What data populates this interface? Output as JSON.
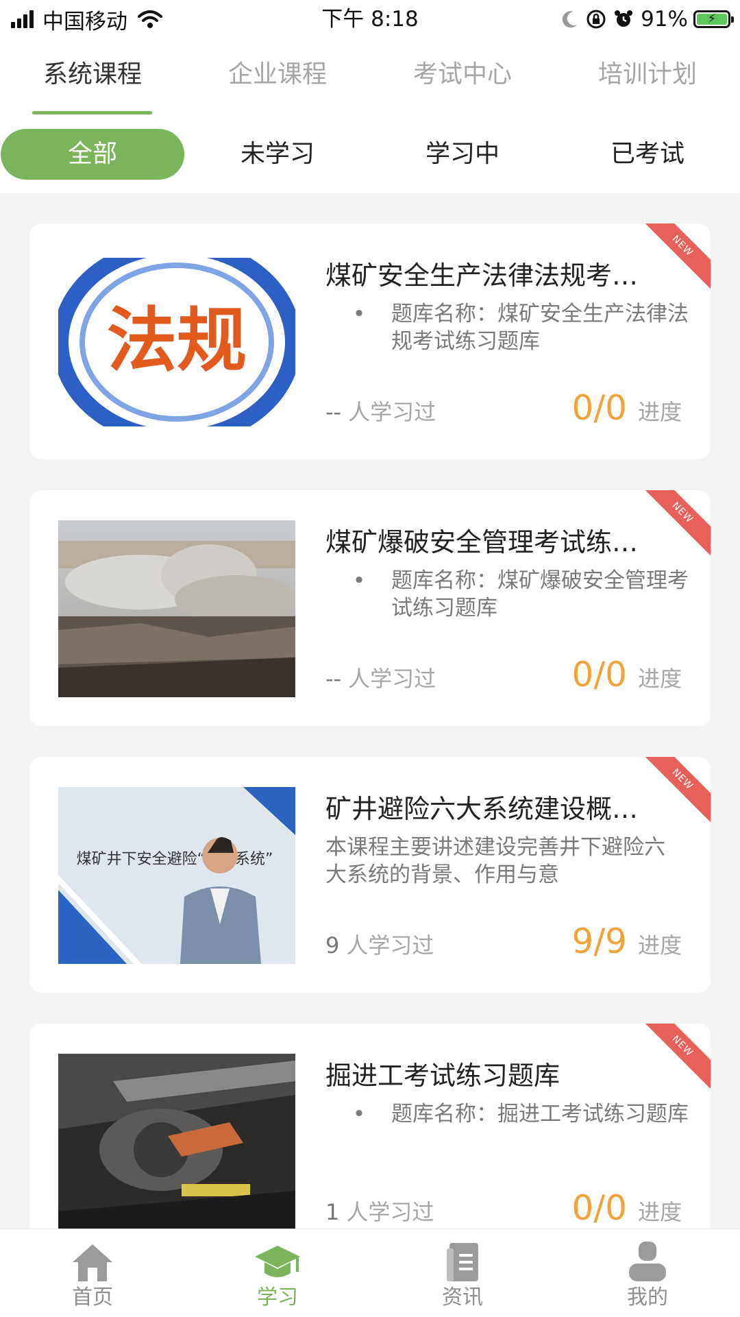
{
  "status_bar": {
    "carrier": "中国移动",
    "time": "下午 8:18",
    "battery_percent": "91%"
  },
  "top_tabs": [
    {
      "label": "系统课程",
      "active": true
    },
    {
      "label": "企业课程",
      "active": false
    },
    {
      "label": "考试中心",
      "active": false
    },
    {
      "label": "培训计划",
      "active": false
    }
  ],
  "filters": [
    {
      "label": "全部",
      "active": true
    },
    {
      "label": "未学习",
      "active": false
    },
    {
      "label": "学习中",
      "active": false
    },
    {
      "label": "已考试",
      "active": false
    }
  ],
  "courses": [
    {
      "title": "煤矿安全生产法律法规考…",
      "bullet": "•",
      "desc": "题库名称：煤矿安全生产法律法规考试练习题库",
      "learners_count": "--",
      "learners_label": "人学习过",
      "progress": "0/0",
      "progress_label": "进度",
      "ribbon": "NEW",
      "thumb_text": "法规"
    },
    {
      "title": "煤矿爆破安全管理考试练…",
      "bullet": "•",
      "desc": "题库名称：煤矿爆破安全管理考试练习题库",
      "learners_count": "--",
      "learners_label": "人学习过",
      "progress": "0/0",
      "progress_label": "进度",
      "ribbon": "NEW"
    },
    {
      "title": "矿井避险六大系统建设概…",
      "desc": "本课程主要讲述建设完善井下避险六大系统的背景、作用与意",
      "learners_count": "9",
      "learners_label": "人学习过",
      "progress": "9/9",
      "progress_label": "进度",
      "ribbon": "NEW",
      "thumb_text": "煤矿井下安全避险“六大系统”"
    },
    {
      "title": "掘进工考试练习题库",
      "bullet": "•",
      "desc": "题库名称：掘进工考试练习题库",
      "learners_count": "1",
      "learners_label": "人学习过",
      "progress": "0/0",
      "progress_label": "进度",
      "ribbon": "NEW"
    }
  ],
  "bottom_nav": [
    {
      "label": "首页",
      "icon": "home-icon",
      "active": false
    },
    {
      "label": "学习",
      "icon": "graduation-cap-icon",
      "active": true
    },
    {
      "label": "资讯",
      "icon": "news-icon",
      "active": false
    },
    {
      "label": "我的",
      "icon": "user-icon",
      "active": false
    }
  ],
  "colors": {
    "accent_green": "#7ab55c",
    "progress_orange": "#f0a33a",
    "ribbon_red": "#e8605a"
  }
}
